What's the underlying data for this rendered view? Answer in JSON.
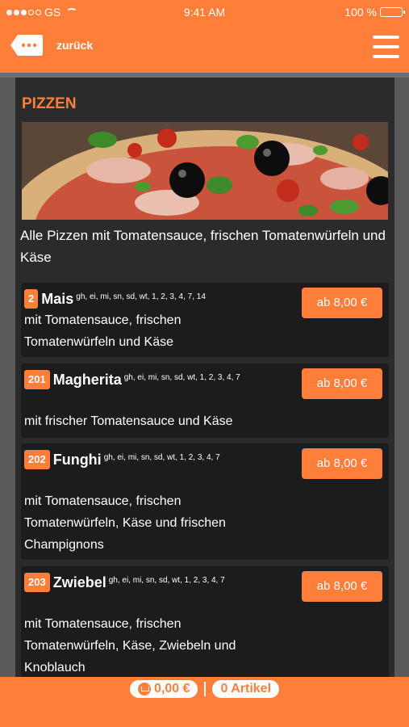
{
  "statusbar": {
    "carrier": "GS",
    "time": "9:41 AM",
    "battery": "100 %"
  },
  "nav": {
    "back_label": "zurück"
  },
  "category": {
    "title": "PIZZEN",
    "description": "Alle Pizzen mit Tomatensauce, frischen Tomatenwürfeln und Käse"
  },
  "items": [
    {
      "number": "2",
      "name": "Mais",
      "allergens": "gh, ei, mi, sn, sd, wt, 1, 2, 3, 4, 7, 14",
      "description": "mit Tomatensauce, frischen Tomatenwürfeln und Käse",
      "price": "ab 8,00 €"
    },
    {
      "number": "201",
      "name": "Magherita",
      "allergens": "gh, ei, mi, sn, sd, wt, 1, 2, 3, 4, 7",
      "description": "mit frischer Tomatensauce und Käse",
      "price": "ab 8,00 €"
    },
    {
      "number": "202",
      "name": "Funghi",
      "allergens": "gh, ei, mi, sn, sd, wt, 1, 2, 3, 4, 7",
      "description": "mit Tomatensauce, frischen Tomatenwürfeln, Käse und frischen Champignons",
      "price": "ab 8,00 €"
    },
    {
      "number": "203",
      "name": "Zwiebel",
      "allergens": "gh, ei, mi, sn, sd, wt, 1, 2, 3, 4, 7",
      "description": "mit Tomatensauce, frischen Tomatenwürfeln, Käse, Zwiebeln und Knoblauch",
      "price": "ab 8,00 €"
    }
  ],
  "cart": {
    "total": "0,00 €",
    "articles": "0 Artikel"
  },
  "colors": {
    "accent": "#ff7f3a",
    "panel": "#2b2b2b",
    "card": "#1c1c1c"
  }
}
